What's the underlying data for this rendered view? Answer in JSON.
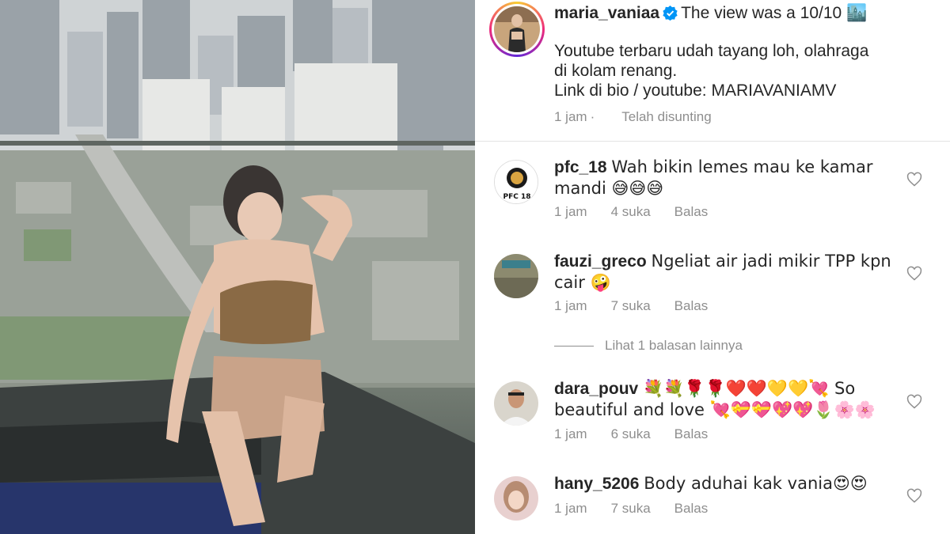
{
  "caption": {
    "username": "maria_vaniaa",
    "verified_icon": "verified-badge-icon",
    "title": "The view was a 10/10 🏙️",
    "body_line1": "Youtube terbaru udah tayang loh, olahraga",
    "body_line2": "di kolam renang.",
    "body_line3": "Link di bio / youtube: MARIAVANIAMV",
    "time": "1 jam",
    "edited": "Telah disunting"
  },
  "comments": [
    {
      "username": "pfc_18",
      "text": "Wah bikin lemes mau ke kamar mandi 😅😅😅",
      "avatar_text": "PFC 18",
      "time": "1 jam",
      "likes": "4 suka",
      "reply": "Balas"
    },
    {
      "username": "fauzi_greco",
      "text": "Ngeliat air jadi mikir TPP kpn cair 🤪",
      "time": "1 jam",
      "likes": "7 suka",
      "reply": "Balas"
    },
    {
      "username": "dara_pouv",
      "text": "💐💐🌹🌹❤️❤️💛💛💘 So beautiful and love 💘💝💝💖💖🌷🌸🌸",
      "time": "1 jam",
      "likes": "6 suka",
      "reply": "Balas"
    },
    {
      "username": "hany_5206",
      "text": "Body aduhai kak vania😍😍",
      "time": "1 jam",
      "likes": "7 suka",
      "reply": "Balas"
    }
  ],
  "more_replies": "Lihat 1 balasan lainnya",
  "colors": {
    "text": "#262626",
    "muted": "#8e8e8e",
    "verified": "#0095f6"
  }
}
